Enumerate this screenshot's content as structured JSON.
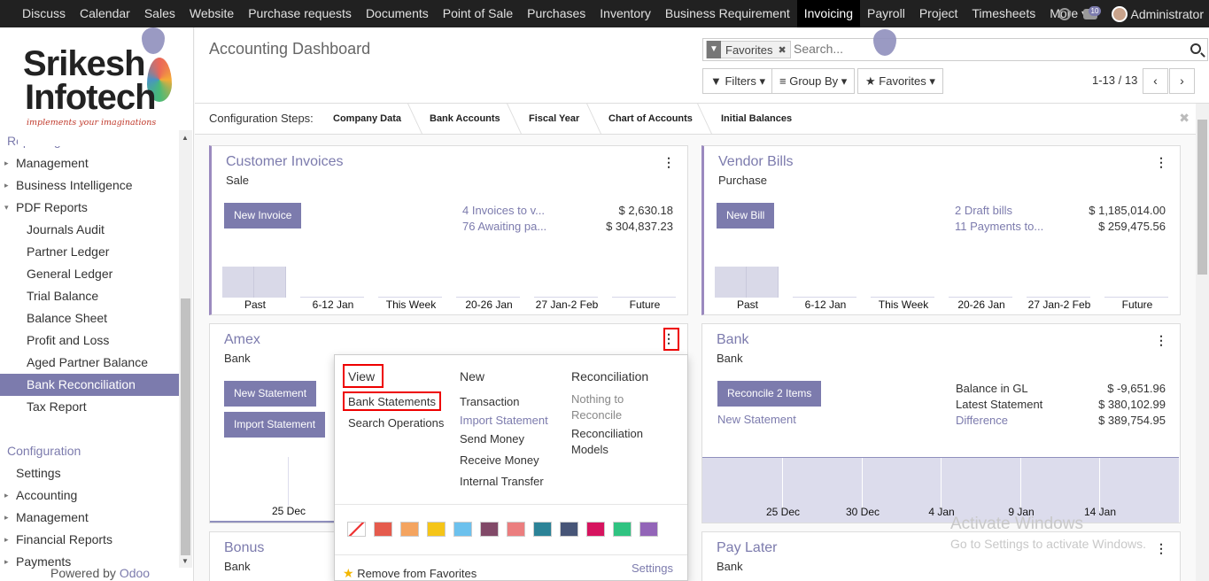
{
  "topbar": {
    "menu": [
      "Discuss",
      "Calendar",
      "Sales",
      "Website",
      "Purchase requests",
      "Documents",
      "Point of Sale",
      "Purchases",
      "Inventory",
      "Business Requirement",
      "Invoicing",
      "Payroll",
      "Project",
      "Timesheets",
      "More"
    ],
    "active": "Invoicing",
    "chat_count": "10",
    "user": "Administrator"
  },
  "logo": {
    "line1": "Srikesh",
    "line2": "Infotech",
    "tagline": "implements your imaginations"
  },
  "sidebar": {
    "items": [
      {
        "label": "Reporting",
        "kind": "sec"
      },
      {
        "label": "Management",
        "kind": "l1",
        "caret": "▸"
      },
      {
        "label": "Business Intelligence",
        "kind": "l1",
        "caret": "▸"
      },
      {
        "label": "PDF Reports",
        "kind": "l1",
        "caret": "▾"
      },
      {
        "label": "Journals Audit",
        "kind": "l2"
      },
      {
        "label": "Partner Ledger",
        "kind": "l2"
      },
      {
        "label": "General Ledger",
        "kind": "l2"
      },
      {
        "label": "Trial Balance",
        "kind": "l2"
      },
      {
        "label": "Balance Sheet",
        "kind": "l2"
      },
      {
        "label": "Profit and Loss",
        "kind": "l2"
      },
      {
        "label": "Aged Partner Balance",
        "kind": "l2"
      },
      {
        "label": "Bank Reconciliation",
        "kind": "l2 sel"
      },
      {
        "label": "Tax Report",
        "kind": "l2"
      },
      {
        "label": "",
        "kind": "l2"
      },
      {
        "label": "Configuration",
        "kind": "sec"
      },
      {
        "label": "Settings",
        "kind": "l1"
      },
      {
        "label": "Accounting",
        "kind": "l1",
        "caret": "▸"
      },
      {
        "label": "Management",
        "kind": "l1",
        "caret": "▸"
      },
      {
        "label": "Financial Reports",
        "kind": "l1",
        "caret": "▸"
      },
      {
        "label": "Payments",
        "kind": "l1",
        "caret": "▸"
      }
    ],
    "powered_by": "Powered by",
    "powered_brand": "Odoo"
  },
  "control_panel": {
    "title": "Accounting Dashboard",
    "facet": "Favorites",
    "search_placeholder": "Search...",
    "filters": "Filters",
    "group_by": "Group By",
    "favorites": "Favorites",
    "pager": "1-13 / 13"
  },
  "config_steps": {
    "label": "Configuration Steps:",
    "steps": [
      "Company Data",
      "Bank Accounts",
      "Fiscal Year",
      "Chart of Accounts",
      "Initial Balances"
    ]
  },
  "cards": {
    "customer_invoices": {
      "title": "Customer Invoices",
      "subtitle": "Sale",
      "button": "New Invoice",
      "link1": "4 Invoices to v...",
      "val1": "$ 2,630.18",
      "link2": "76 Awaiting pa...",
      "val2": "$ 304,837.23",
      "axis": [
        "Past",
        "6-12 Jan",
        "This Week",
        "20-26 Jan",
        "27 Jan-2 Feb",
        "Future"
      ]
    },
    "vendor_bills": {
      "title": "Vendor Bills",
      "subtitle": "Purchase",
      "button": "New Bill",
      "link1": "2 Draft bills",
      "val1": "$ 1,185,014.00",
      "link2": "11 Payments to...",
      "val2": "$ 259,475.56",
      "axis": [
        "Past",
        "6-12 Jan",
        "This Week",
        "20-26 Jan",
        "27 Jan-2 Feb",
        "Future"
      ]
    },
    "amex": {
      "title": "Amex",
      "subtitle": "Bank",
      "button1": "New Statement",
      "button2": "Import Statement",
      "axis_label": "25 Dec"
    },
    "bank": {
      "title": "Bank",
      "subtitle": "Bank",
      "button": "Reconcile 2 Items",
      "link": "New Statement",
      "row1_label": "Balance in GL",
      "row1_val": "$ -9,651.96",
      "row2_label": "Latest Statement",
      "row2_val": "$ 380,102.99",
      "row3_label": "Difference",
      "row3_val": "$ 389,754.95",
      "axis": [
        "25 Dec",
        "30 Dec",
        "4 Jan",
        "9 Jan",
        "14 Jan"
      ]
    },
    "bonus": {
      "title": "Bonus",
      "subtitle": "Bank"
    },
    "pay_later": {
      "title": "Pay Later",
      "subtitle": "Bank"
    }
  },
  "dropdown": {
    "view_header": "View",
    "view_items": [
      "Bank Statements",
      "Search Operations"
    ],
    "new_header": "New",
    "new_items": [
      "Transaction",
      "Import Statement",
      "Send Money",
      "Receive Money",
      "Internal Transfer"
    ],
    "recon_header": "Reconciliation",
    "recon_items": [
      "Nothing to",
      "Reconcile",
      "Reconciliation",
      "Models"
    ],
    "colors": [
      "#ffffff",
      "#e55b4d",
      "#f4a460",
      "#f5c518",
      "#6cc1ed",
      "#814968",
      "#eb7e7f",
      "#2c8397",
      "#475577",
      "#d6145f",
      "#30c381",
      "#9365b8"
    ],
    "remove_favorites": "Remove from Favorites",
    "settings": "Settings"
  },
  "watermark": {
    "line1": "Activate Windows",
    "line2": "Go to Settings to activate Windows."
  }
}
